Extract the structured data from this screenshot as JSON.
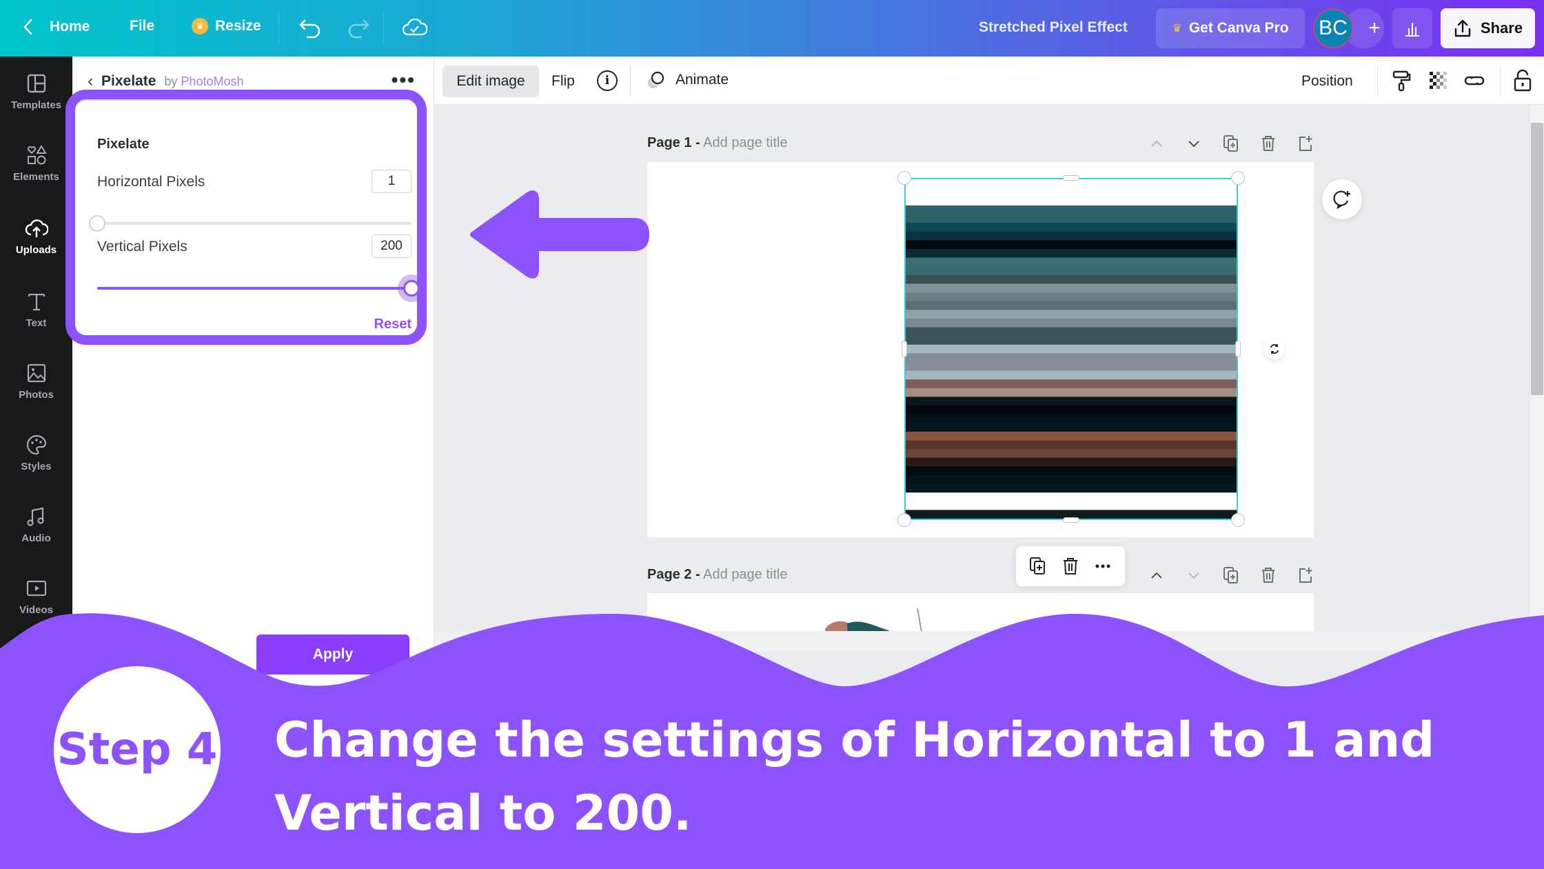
{
  "topbar": {
    "home": "Home",
    "file": "File",
    "resize": "Resize",
    "title": "Stretched Pixel Effect",
    "get_pro": "Get Canva Pro",
    "avatar_initials": "BC",
    "add": "+",
    "share": "Share"
  },
  "rail": {
    "items": [
      {
        "label": "Templates",
        "icon": "templates-icon"
      },
      {
        "label": "Elements",
        "icon": "elements-icon"
      },
      {
        "label": "Uploads",
        "icon": "uploads-icon",
        "active": true
      },
      {
        "label": "Text",
        "icon": "text-icon"
      },
      {
        "label": "Photos",
        "icon": "photos-icon"
      },
      {
        "label": "Styles",
        "icon": "styles-icon"
      },
      {
        "label": "Audio",
        "icon": "audio-icon"
      },
      {
        "label": "Videos",
        "icon": "videos-icon"
      }
    ]
  },
  "panel": {
    "title": "Pixelate",
    "by": "by",
    "author": "PhotoMosh",
    "effect_title": "Pixelate",
    "horizontal": {
      "label": "Horizontal Pixels",
      "value": "1",
      "fraction": 0.0
    },
    "vertical": {
      "label": "Vertical Pixels",
      "value": "200",
      "fraction": 1.0
    },
    "reset": "Reset",
    "apply": "Apply"
  },
  "context_toolbar": {
    "edit_image": "Edit image",
    "flip": "Flip",
    "info": "i",
    "animate": "Animate",
    "position": "Position"
  },
  "pages": [
    {
      "label": "Page 1 -",
      "placeholder": "Add page title"
    },
    {
      "label": "Page 2 -",
      "placeholder": "Add page title"
    }
  ],
  "overlay": {
    "step": "Step 4",
    "instruction_line1": "Change the settings of Horizontal to 1 and",
    "instruction_line2": "Vertical to 200.",
    "accent_color": "#8c52ff"
  },
  "image_stripes": [
    "#ffffff",
    "#ffffff",
    "#ffffff",
    "#2f6268",
    "#2b6369",
    "#0b4a55",
    "#06333d",
    "#01080c",
    "#0b2b33",
    "#3c6e74",
    "#3a6a72",
    "#3c4e52",
    "#7f9298",
    "#6c7f85",
    "#5e6f74",
    "#8fa2a8",
    "#7a8b90",
    "#3e545b",
    "#3c545b",
    "#a6b8c0",
    "#868e93",
    "#859096",
    "#a4b7bf",
    "#7e5e58",
    "#a88c84",
    "#0a161d",
    "#01070d",
    "#021118",
    "#021620",
    "#8c5440",
    "#59352a",
    "#6a4435",
    "#2b1b16",
    "#020a10",
    "#02131b",
    "#031a23",
    "#ffffff",
    "#ffffff",
    "#111a1f"
  ]
}
